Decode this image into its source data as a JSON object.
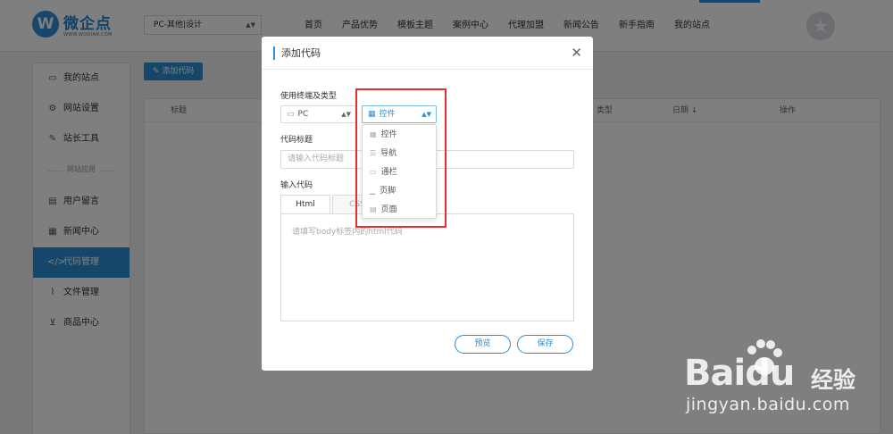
{
  "header": {
    "logo_mark": "W",
    "logo_name": "微企点",
    "logo_domain": "WWW.WQDIAN.COM",
    "site_select": "PC-其他|设计",
    "nav": [
      "首页",
      "产品优势",
      "模板主题",
      "案例中心",
      "代理加盟",
      "新闻公告",
      "新手指南",
      "我的站点"
    ]
  },
  "sidebar": {
    "items_top": [
      {
        "icon": "monitor-icon",
        "label": "我的站点"
      },
      {
        "icon": "gear-icon",
        "label": "网站设置"
      },
      {
        "icon": "wrench-icon",
        "label": "站长工具"
      }
    ],
    "group_label": "网站应用",
    "items_bottom": [
      {
        "icon": "message-icon",
        "label": "用户留言"
      },
      {
        "icon": "news-icon",
        "label": "新闻中心"
      },
      {
        "icon": "code-icon",
        "label": "代码管理"
      },
      {
        "icon": "paperclip-icon",
        "label": "文件管理"
      },
      {
        "icon": "cart-icon",
        "label": "商品中心"
      }
    ],
    "active_label": "代码管理"
  },
  "main": {
    "add_button": "添加代码",
    "table_headers": {
      "title": "标题",
      "type": "类型",
      "date": "日期 ↓",
      "actions": "操作"
    }
  },
  "modal": {
    "title": "添加代码",
    "terminal_type_label": "使用终端及类型",
    "terminal_select": "PC",
    "type_select": "控件",
    "type_options": [
      "控件",
      "导航",
      "通栏",
      "页脚",
      "页面"
    ],
    "code_title_label": "代码标题",
    "code_title_placeholder": "请输入代码标题",
    "code_input_label": "输入代码",
    "tabs": [
      "Html",
      "CSS"
    ],
    "code_placeholder": "请填写body标签内的html代码",
    "preview_button": "预览",
    "save_button": "保存"
  },
  "watermark": {
    "brand": "Baidu",
    "sub": "经验",
    "url": "jingyan.baidu.com"
  },
  "colors": {
    "accent": "#2b8ed6",
    "highlight": "#e0322d"
  }
}
